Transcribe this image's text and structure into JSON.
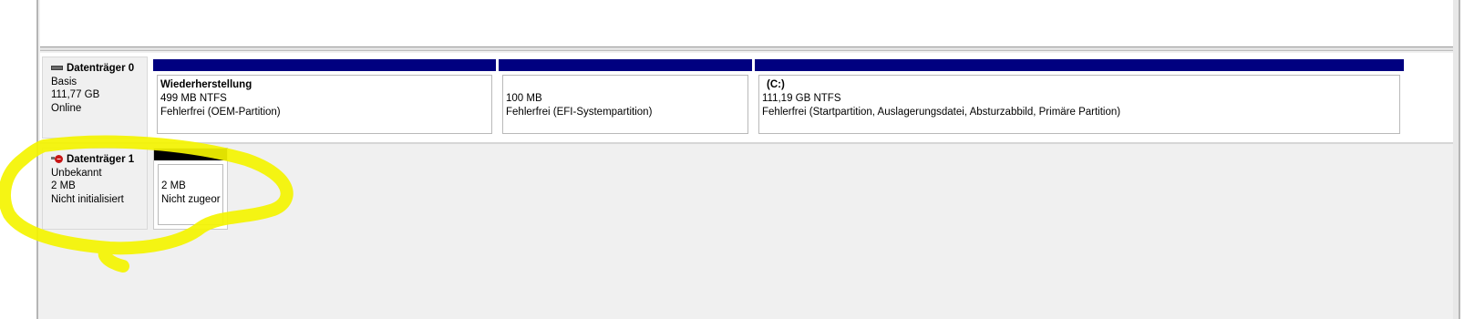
{
  "colors": {
    "primary_partition_bar": "#000080",
    "unallocated_bar": "#000000",
    "highlight_scribble": "#f4f400"
  },
  "disks": [
    {
      "title": "Datenträger 0",
      "type": "Basis",
      "size": "111,77 GB",
      "status": "Online",
      "icon": "hard-disk-icon",
      "partitions": [
        {
          "name": "Wiederherstellung",
          "size_fs": "499 MB NTFS",
          "status": "Fehlerfrei (OEM-Partition)"
        },
        {
          "name": "",
          "size_fs": "100 MB",
          "status": "Fehlerfrei (EFI-Systempartition)"
        },
        {
          "name": "(C:)",
          "size_fs": "111,19 GB NTFS",
          "status": "Fehlerfrei (Startpartition, Auslagerungsdatei, Absturzabbild, Primäre Partition)"
        }
      ]
    },
    {
      "title": "Datenträger 1",
      "type": "Unbekannt",
      "size": "2 MB",
      "status": "Nicht initialisiert",
      "icon": "disk-error-icon",
      "partitions": [
        {
          "size": "2 MB",
          "status": "Nicht zugeor"
        }
      ]
    }
  ]
}
